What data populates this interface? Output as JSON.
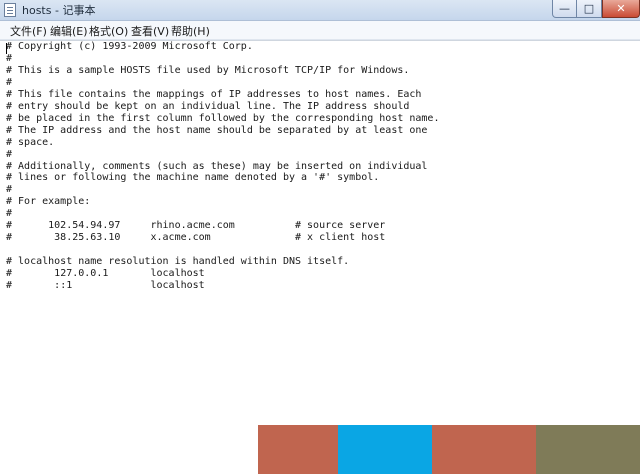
{
  "window": {
    "title": "hosts - 记事本",
    "controls": {
      "minimize": "—",
      "maximize": "□",
      "close": "✕"
    }
  },
  "menu": {
    "file": "文件(F)",
    "edit": "编辑(E)",
    "format": "格式(O)",
    "view": "查看(V)",
    "help": "帮助(H)"
  },
  "document": {
    "content": "# Copyright (c) 1993-2009 Microsoft Corp.\n#\n# This is a sample HOSTS file used by Microsoft TCP/IP for Windows.\n#\n# This file contains the mappings of IP addresses to host names. Each\n# entry should be kept on an individual line. The IP address should\n# be placed in the first column followed by the corresponding host name.\n# The IP address and the host name should be separated by at least one\n# space.\n#\n# Additionally, comments (such as these) may be inserted on individual\n# lines or following the machine name denoted by a '#' symbol.\n#\n# For example:\n#\n#      102.54.94.97     rhino.acme.com          # source server\n#       38.25.63.10     x.acme.com              # x client host\n\n# localhost name resolution is handled within DNS itself.\n#\t127.0.0.1       localhost\n#\t::1             localhost"
  },
  "colors": {
    "watermark_red": "#c0654f",
    "watermark_blue": "#0aa6e4",
    "watermark_olive": "#7f7b58"
  }
}
